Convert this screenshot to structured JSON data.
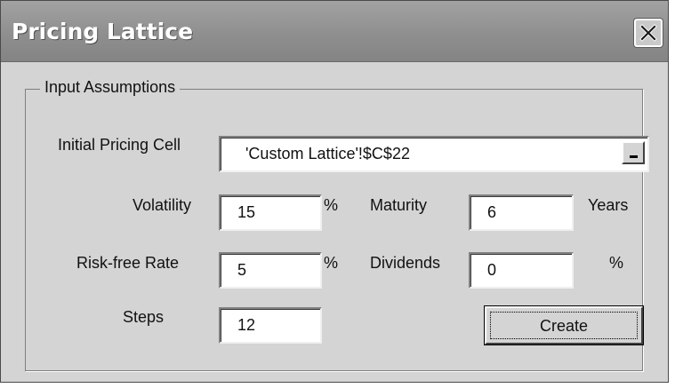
{
  "window": {
    "title": "Pricing Lattice",
    "close_icon": "close-icon"
  },
  "group": {
    "legend": "Input Assumptions"
  },
  "initial_pricing_cell": {
    "label": "Initial Pricing Cell",
    "value": "'Custom Lattice'!$C$22",
    "ref_button_icon": "minimize-dash-icon"
  },
  "volatility": {
    "label": "Volatility",
    "value": "15",
    "unit": "%"
  },
  "maturity": {
    "label": "Maturity",
    "value": "6",
    "unit": "Years"
  },
  "risk_free_rate": {
    "label": "Risk-free Rate",
    "value": "5",
    "unit": "%"
  },
  "dividends": {
    "label": "Dividends",
    "value": "0",
    "unit": "%"
  },
  "steps": {
    "label": "Steps",
    "value": "12"
  },
  "create_button": {
    "label": "Create"
  }
}
